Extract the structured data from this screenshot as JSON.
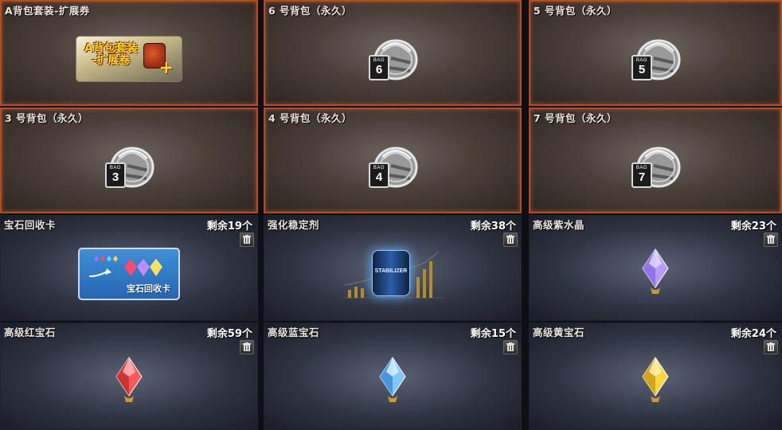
{
  "items": [
    {
      "title": "A背包套装-扩展券",
      "count": "",
      "coupon_line1": "A背包套装",
      "coupon_line2": "-扩展卷",
      "coupon_plus": "+"
    },
    {
      "title": "6 号背包（永久）",
      "count": "",
      "bag_word": "BAG",
      "bag_number": "6"
    },
    {
      "title": "5 号背包（永久）",
      "count": "",
      "bag_word": "BAG",
      "bag_number": "5"
    },
    {
      "title": "3 号背包（永久）",
      "count": "",
      "bag_word": "BAG",
      "bag_number": "3"
    },
    {
      "title": "4 号背包（永久）",
      "count": "",
      "bag_word": "BAG",
      "bag_number": "4"
    },
    {
      "title": "7 号背包（永久）",
      "count": "",
      "bag_word": "BAG",
      "bag_number": "7"
    },
    {
      "title": "宝石回收卡",
      "count": "剩余19个",
      "card_text": "宝石回收卡"
    },
    {
      "title": "强化稳定剂",
      "count": "剩余38个",
      "jar_text": "STABILIZER"
    },
    {
      "title": "高级紫水晶",
      "count": "剩余23个",
      "gem_color": "#b89cff"
    },
    {
      "title": "高级红宝石",
      "count": "剩余59个",
      "gem_color": "#ff5a5a"
    },
    {
      "title": "高级蓝宝石",
      "count": "剩余15个",
      "gem_color": "#7fc8ff"
    },
    {
      "title": "高级黄宝石",
      "count": "剩余24个",
      "gem_color": "#ffd640"
    }
  ],
  "colors": {
    "bag_border": "#b84a1e",
    "text": "#e8e4dc"
  },
  "icons": {
    "trash": "trash-icon",
    "bag": "backpack-icon",
    "gem": "gem-icon"
  }
}
